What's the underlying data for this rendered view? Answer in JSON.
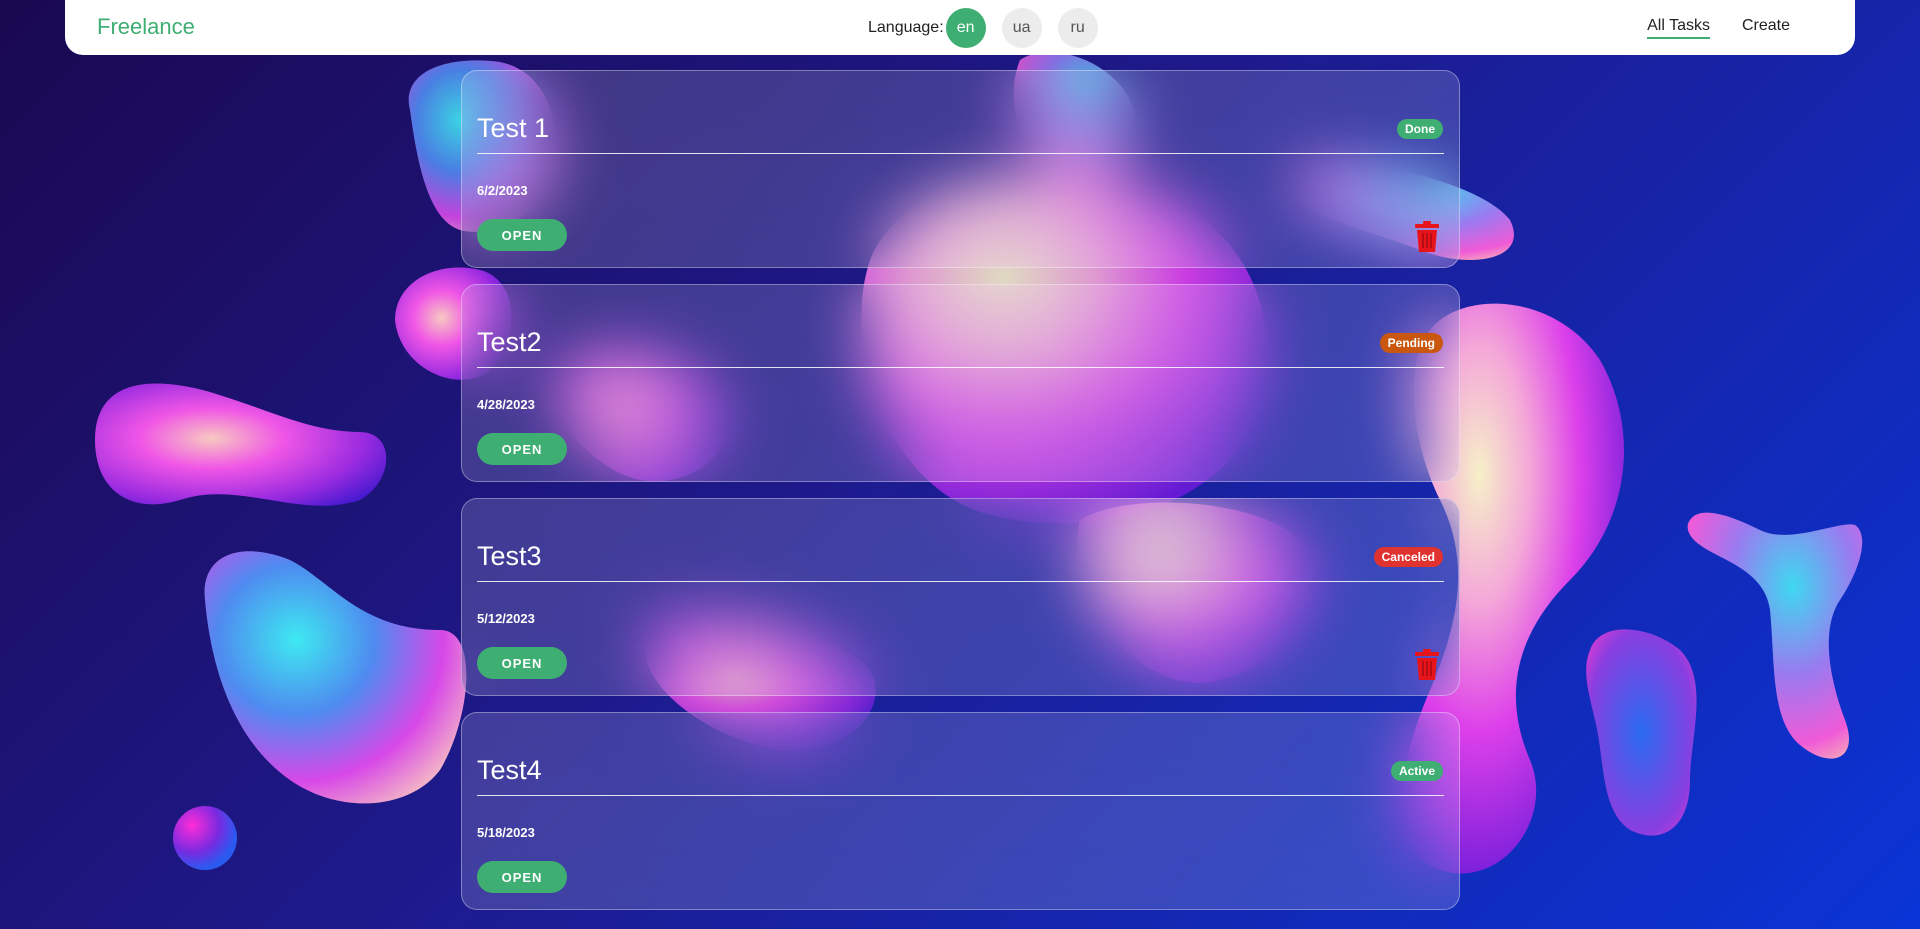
{
  "navbar": {
    "brand": "Freelance",
    "language_label": "Language:",
    "languages": [
      "en",
      "ua",
      "ru"
    ],
    "active_language": "en",
    "links": [
      "All Tasks",
      "Create"
    ],
    "active_link": "All Tasks"
  },
  "tasks": [
    {
      "title": "Test 1",
      "status": "Done",
      "date": "6/2/2023",
      "open_label": "OPEN",
      "deletable": true
    },
    {
      "title": "Test2",
      "status": "Pending",
      "date": "4/28/2023",
      "open_label": "OPEN",
      "deletable": false
    },
    {
      "title": "Test3",
      "status": "Canceled",
      "date": "5/12/2023",
      "open_label": "OPEN",
      "deletable": true
    },
    {
      "title": "Test4",
      "status": "Active",
      "date": "5/18/2023",
      "open_label": "OPEN",
      "deletable": false
    }
  ],
  "colors": {
    "accent": "#3fae73",
    "status_done": "#3fae73",
    "status_pending": "#c9570f",
    "status_canceled": "#e0332f",
    "status_active": "#3fae73",
    "delete": "#e8141c"
  },
  "icons": {
    "delete": "trash-icon"
  }
}
